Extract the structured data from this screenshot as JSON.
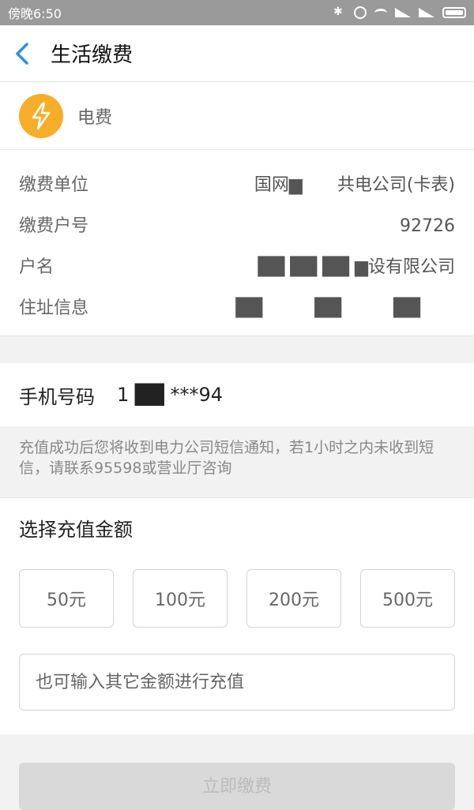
{
  "status_bar": {
    "time": "傍晚6:50",
    "icons": [
      "bluetooth-icon",
      "alarm-icon",
      "wifi-icon",
      "signal-icon",
      "signal-icon",
      "battery-icon"
    ],
    "color": "#9a9a9a"
  },
  "nav": {
    "title": "生活缴费",
    "back_icon": "chevron-left-icon",
    "accent_color": "#2a90e0"
  },
  "service": {
    "name": "电费",
    "icon": "lightning-icon",
    "icon_color": "#f6ad28"
  },
  "info": [
    {
      "label": "缴费单位",
      "value": "国网▆　　共电公司(卡表)"
    },
    {
      "label": "缴费户号",
      "value": "　　　　　　92726"
    },
    {
      "label": "户名",
      "value": "██ ██ ██ ▆设有限公司"
    },
    {
      "label": "住址信息",
      "value": "██　　　██　　　██　　"
    }
  ],
  "phone": {
    "label": "手机号码",
    "value": "1 ██ ***94"
  },
  "notice": {
    "text": "充值成功后您将收到电力公司短信通知，若1小时之内未收到短信，请联系95598或营业厅咨询"
  },
  "amount": {
    "title": "选择充值金额",
    "options": [
      "50元",
      "100元",
      "200元",
      "500元"
    ],
    "custom_placeholder": "也可输入其它金额进行充值"
  },
  "pay_button": {
    "label": "立即缴费"
  }
}
